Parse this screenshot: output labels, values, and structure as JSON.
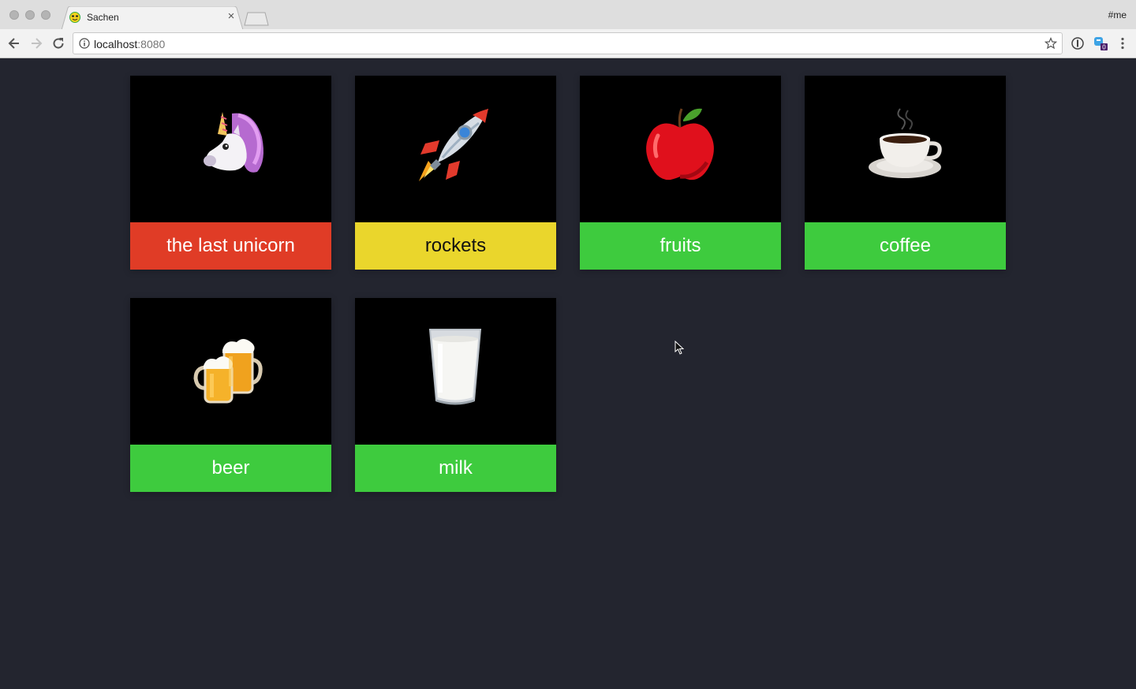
{
  "browser": {
    "tab_title": "Sachen",
    "profile_label": "#me",
    "url_host": "localhost",
    "url_port": ":8080",
    "extension_badge": "0"
  },
  "cards": [
    {
      "label": "the last unicorn",
      "icon": "unicorn-icon",
      "label_bg": "#e03c26",
      "label_color": "#ffffff"
    },
    {
      "label": "rockets",
      "icon": "rocket-icon",
      "label_bg": "#ead62c",
      "label_color": "#111111"
    },
    {
      "label": "fruits",
      "icon": "apple-icon",
      "label_bg": "#3ecb3e",
      "label_color": "#ffffff"
    },
    {
      "label": "coffee",
      "icon": "coffee-icon",
      "label_bg": "#3ecb3e",
      "label_color": "#ffffff"
    },
    {
      "label": "beer",
      "icon": "beer-mugs-icon",
      "label_bg": "#3ecb3e",
      "label_color": "#ffffff"
    },
    {
      "label": "milk",
      "icon": "milk-glass-icon",
      "label_bg": "#3ecb3e",
      "label_color": "#ffffff"
    }
  ],
  "colors": {
    "page_bg": "#23252f",
    "card_art_bg": "#000000"
  }
}
